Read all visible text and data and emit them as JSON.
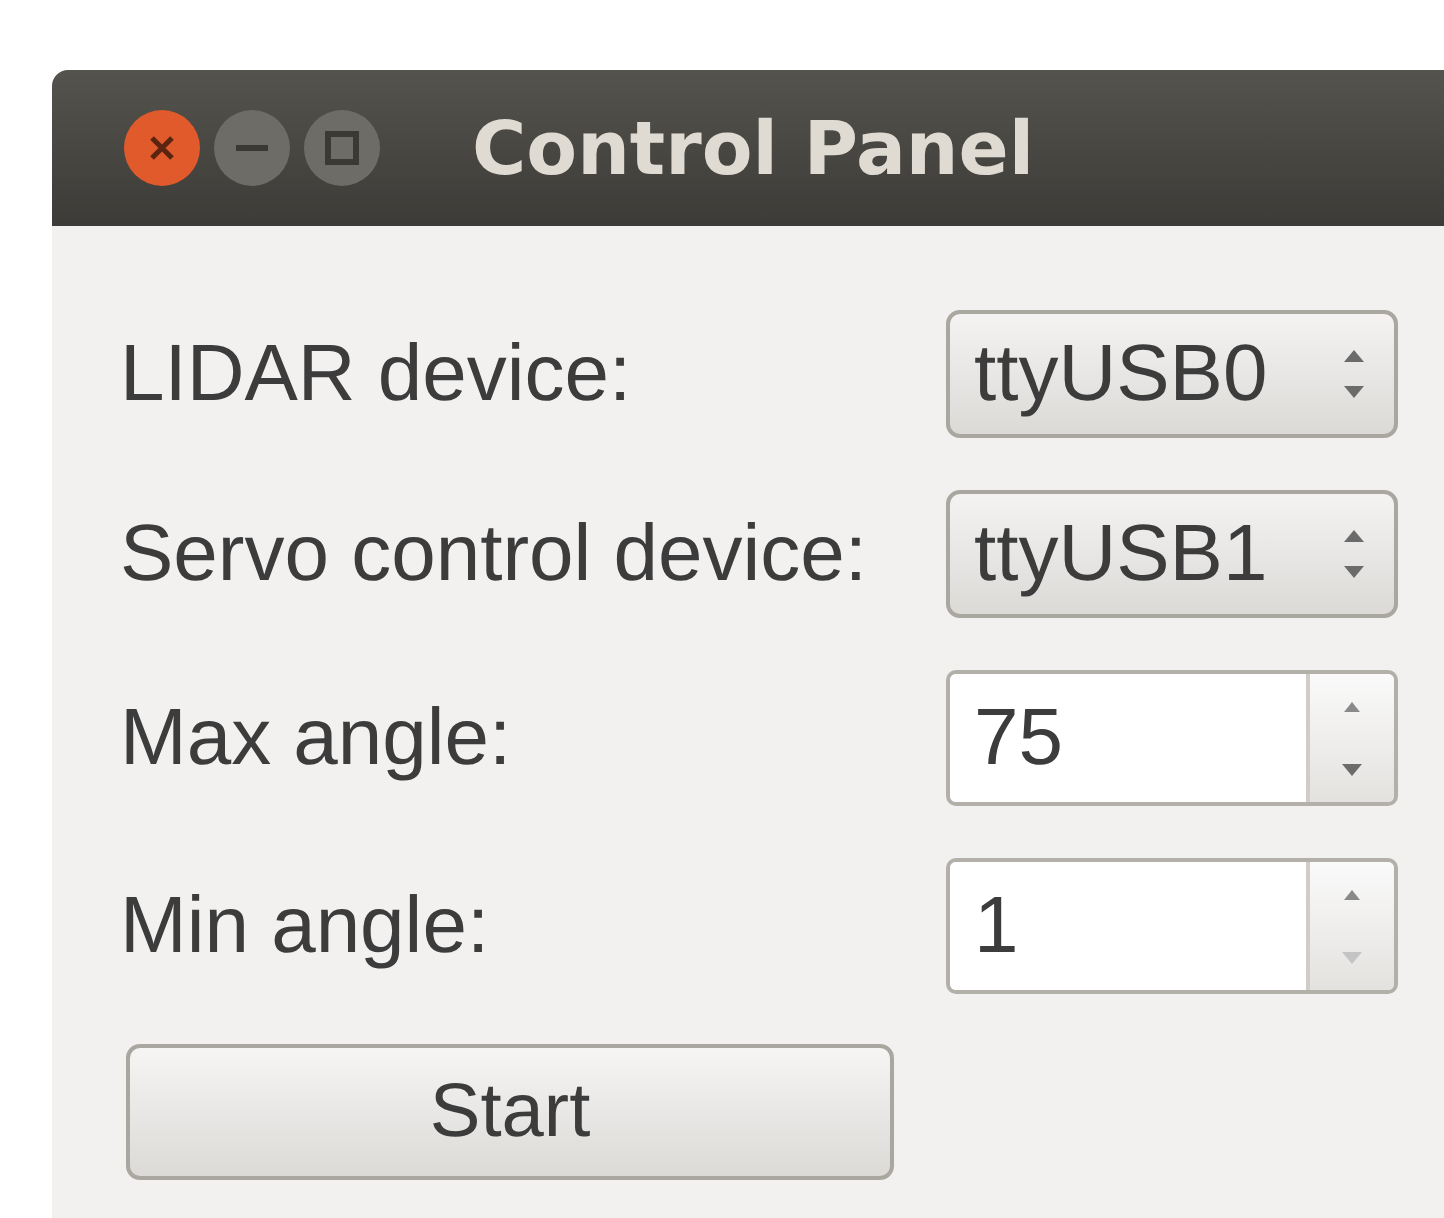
{
  "window": {
    "title": "Control Panel"
  },
  "fields": [
    {
      "kind": "combo",
      "label": "LIDAR device:",
      "value": "ttyUSB0"
    },
    {
      "kind": "combo",
      "label": "Servo control device:",
      "value": "ttyUSB1"
    },
    {
      "kind": "spin",
      "label": "Max angle:",
      "value": "75",
      "down_disabled": false
    },
    {
      "kind": "spin",
      "label": "Min angle:",
      "value": "1",
      "down_disabled": true
    }
  ],
  "buttons": [
    {
      "label": "Start"
    }
  ]
}
